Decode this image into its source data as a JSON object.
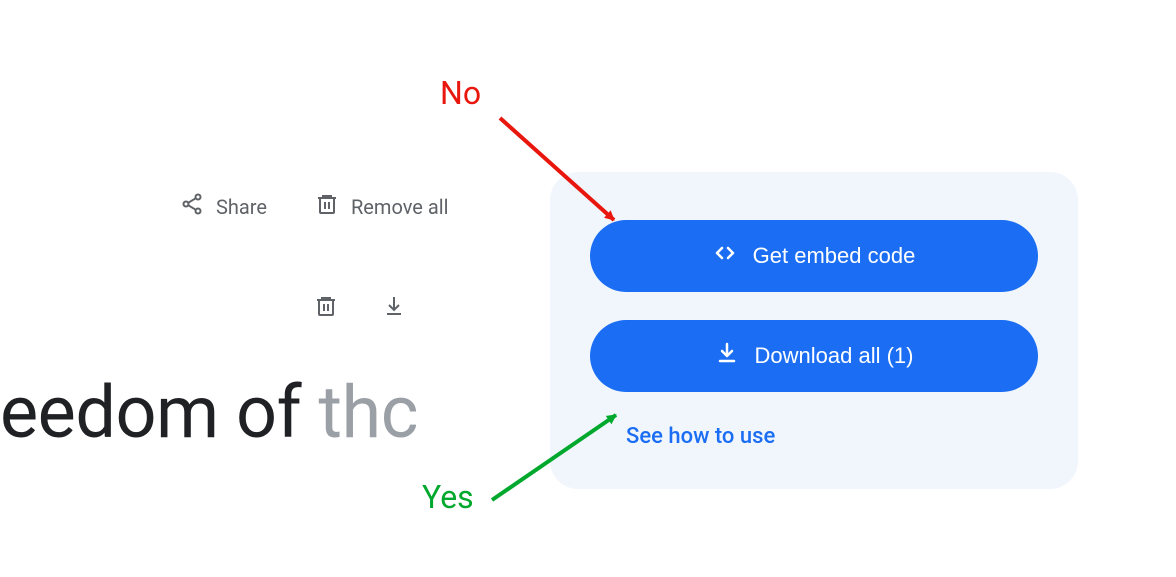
{
  "toolbar": {
    "share_label": "Share",
    "remove_all_label": "Remove all"
  },
  "heading": {
    "visible_dark": "eedom of ",
    "visible_fade": "thc"
  },
  "panel": {
    "embed_label": "Get embed code",
    "download_label": "Download all (1)",
    "link_label": "See how to use"
  },
  "annotations": {
    "no": "No",
    "yes": "Yes"
  },
  "colors": {
    "accent": "#1b6ef3",
    "no": "#e8160c",
    "yes": "#00a82d",
    "panel_bg": "#f1f6fd",
    "muted": "#5f6368"
  }
}
